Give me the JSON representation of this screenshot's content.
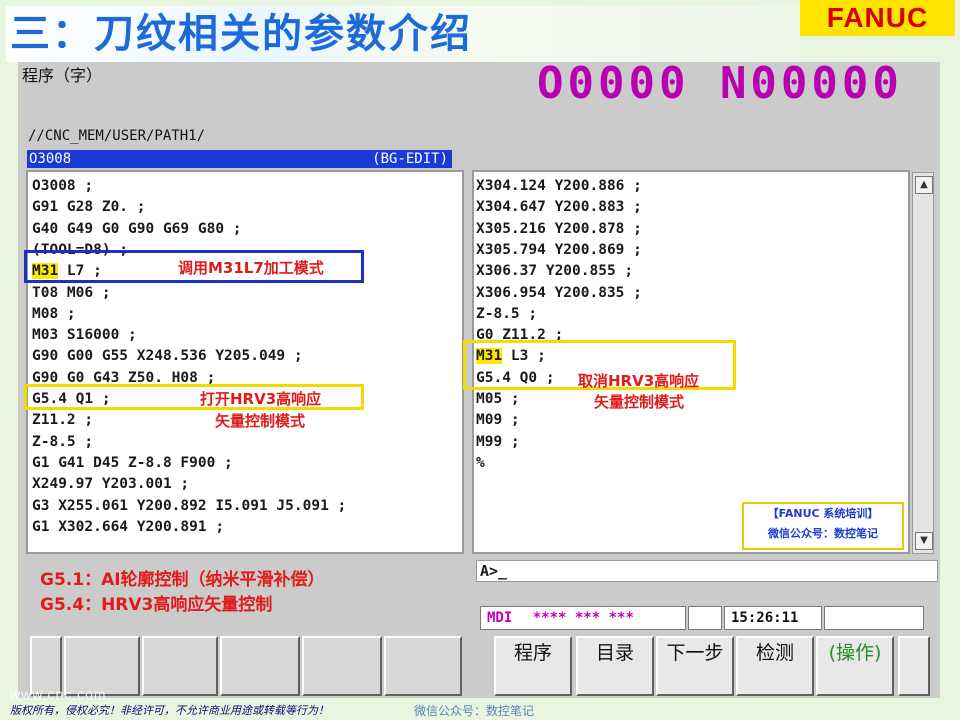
{
  "slide": {
    "title": "三：刀纹相关的参数介绍",
    "brand": "FANUC",
    "copyright": "版权所有，侵权必究！非经许可，不允许商业用途或转载等行为！",
    "watermark": "www.cnc.com",
    "footer_wechat": "微信公众号：数控笔记"
  },
  "screen": {
    "name": "程序（字）",
    "program_number": "O0000 N00000",
    "path": "//CNC_MEM/USER/PATH1/",
    "program_name": "O3008",
    "edit_mode": "(BG-EDIT)"
  },
  "program_left": [
    "O3008 ;",
    "G91 G28 Z0. ;",
    "G40 G49 G0 G90 G69 G80 ;",
    "(TOOL=D8) ;",
    "M31 L7 ;",
    "T08 M06 ;",
    "M08 ;",
    "M03 S16000 ;",
    "G90 G00 G55 X248.536 Y205.049 ;",
    "G90 G0 G43 Z50. H08 ;",
    "G5.4 Q1 ;",
    "Z11.2 ;",
    "Z-8.5 ;",
    "G1 G41 D45 Z-8.8 F900 ;",
    "X249.97 Y203.001 ;",
    "G3 X255.061 Y200.892 I5.091 J5.091 ;",
    "G1 X302.664 Y200.891 ;"
  ],
  "program_right": [
    "X304.124 Y200.886 ;",
    "X304.647 Y200.883 ;",
    "X305.216 Y200.878 ;",
    "X305.794 Y200.869 ;",
    "X306.37 Y200.855 ;",
    "X306.954 Y200.835 ;",
    "Z-8.5 ;",
    "G0 Z11.2 ;",
    "M31 L3 ;",
    "G5.4 Q0 ;",
    "M05 ;",
    "M09 ;",
    "M99 ;",
    "%"
  ],
  "highlight_word": "M31",
  "annotations": {
    "call_m31": "调用M31L7加工模式",
    "enable_hrv3_line1": "打开HRV3高响应",
    "enable_hrv3_line2": "矢量控制模式",
    "cancel_hrv3_line1": "取消HRV3高响应",
    "cancel_hrv3_line2": "矢量控制模式"
  },
  "training_badge": {
    "line1": "【FANUC 系统培训】",
    "line2": "微信公众号：数控笔记"
  },
  "notes": {
    "g51": "G5.1：AI轮廓控制（纳米平滑补偿）",
    "g54": "G5.4：HRV3高响应矢量控制"
  },
  "input_prompt": "A>_",
  "status": {
    "mode": "MDI",
    "alarms": "**** *** ***",
    "time": "15:26:11"
  },
  "softkeys": [
    "程序",
    "目录",
    "下一步",
    "检测",
    "(操作)"
  ],
  "colors": {
    "title_blue": "#1e6ad8",
    "brand_red": "#d80000",
    "brand_yellow": "#ffe400",
    "program_magenta": "#b800b0",
    "header_blue": "#1b39d6",
    "annotation_red": "#e11b1b",
    "highlight_yellow": "#ffe800",
    "box_blue": "#1b2fc0",
    "box_yellow": "#f2dc00",
    "mode_magenta": "#c000b8",
    "softkey_green": "#2a8a2a"
  }
}
